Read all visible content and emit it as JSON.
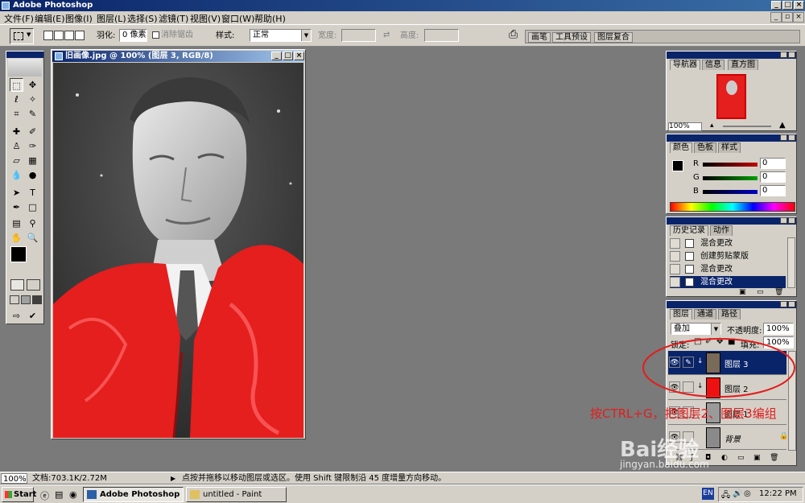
{
  "window": {
    "title": "Adobe Photoshop"
  },
  "menu": [
    "文件(F)",
    "编辑(E)",
    "图像(I)",
    "图层(L)",
    "选择(S)",
    "滤镜(T)",
    "视图(V)",
    "窗口(W)",
    "帮助(H)"
  ],
  "options": {
    "feather_label": "羽化:",
    "feather_value": "0 像素",
    "antialias_label": "消除锯齿",
    "style_label": "样式:",
    "style_value": "正常",
    "width_label": "宽度:",
    "height_label": "高度:",
    "palette_tabs": [
      "画笔",
      "工具预设",
      "图层复合"
    ]
  },
  "document": {
    "title": "旧画像.jpg @ 100% (图层 3, RGB/8)"
  },
  "navigator": {
    "tabs": [
      "导航器",
      "信息",
      "直方图"
    ],
    "zoom": "100%"
  },
  "color": {
    "tabs": [
      "颜色",
      "色板",
      "样式"
    ],
    "channels": [
      {
        "label": "R",
        "value": "0",
        "color": "#c00000"
      },
      {
        "label": "G",
        "value": "0",
        "color": "#00a000"
      },
      {
        "label": "B",
        "value": "0",
        "color": "#0000c0"
      }
    ]
  },
  "history": {
    "tabs": [
      "历史记录",
      "动作"
    ],
    "items": [
      "混合更改",
      "创建剪贴蒙版",
      "混合更改",
      "混合更改"
    ],
    "selected_index": 3
  },
  "layers": {
    "tabs": [
      "图层",
      "通道",
      "路径"
    ],
    "blend_mode": "叠加",
    "opacity_label": "不透明度:",
    "opacity_value": "100%",
    "lock_label": "锁定:",
    "fill_label": "填充:",
    "fill_value": "100%",
    "items": [
      {
        "name": "图层 3",
        "selected": true
      },
      {
        "name": "图层 2",
        "selected": false
      },
      {
        "name": "图层 1",
        "selected": false
      },
      {
        "name": "背景",
        "selected": false
      }
    ]
  },
  "annotation": "按CTRL+G，把图层2、图层3编组",
  "statusbar": {
    "zoom": "100%",
    "doc_info": "文档:703.1K/2.72M",
    "hint": "点按并拖移以移动图层或选区。使用 Shift 键限制沿 45 度增量方向移动。"
  },
  "taskbar": {
    "start": "Start",
    "buttons": [
      "Adobe Photoshop",
      "untitled - Paint"
    ],
    "lang": "EN",
    "time": "12:22 PM"
  },
  "watermark": {
    "brand": "Bai经验",
    "url": "jingyan.baidu.com"
  }
}
